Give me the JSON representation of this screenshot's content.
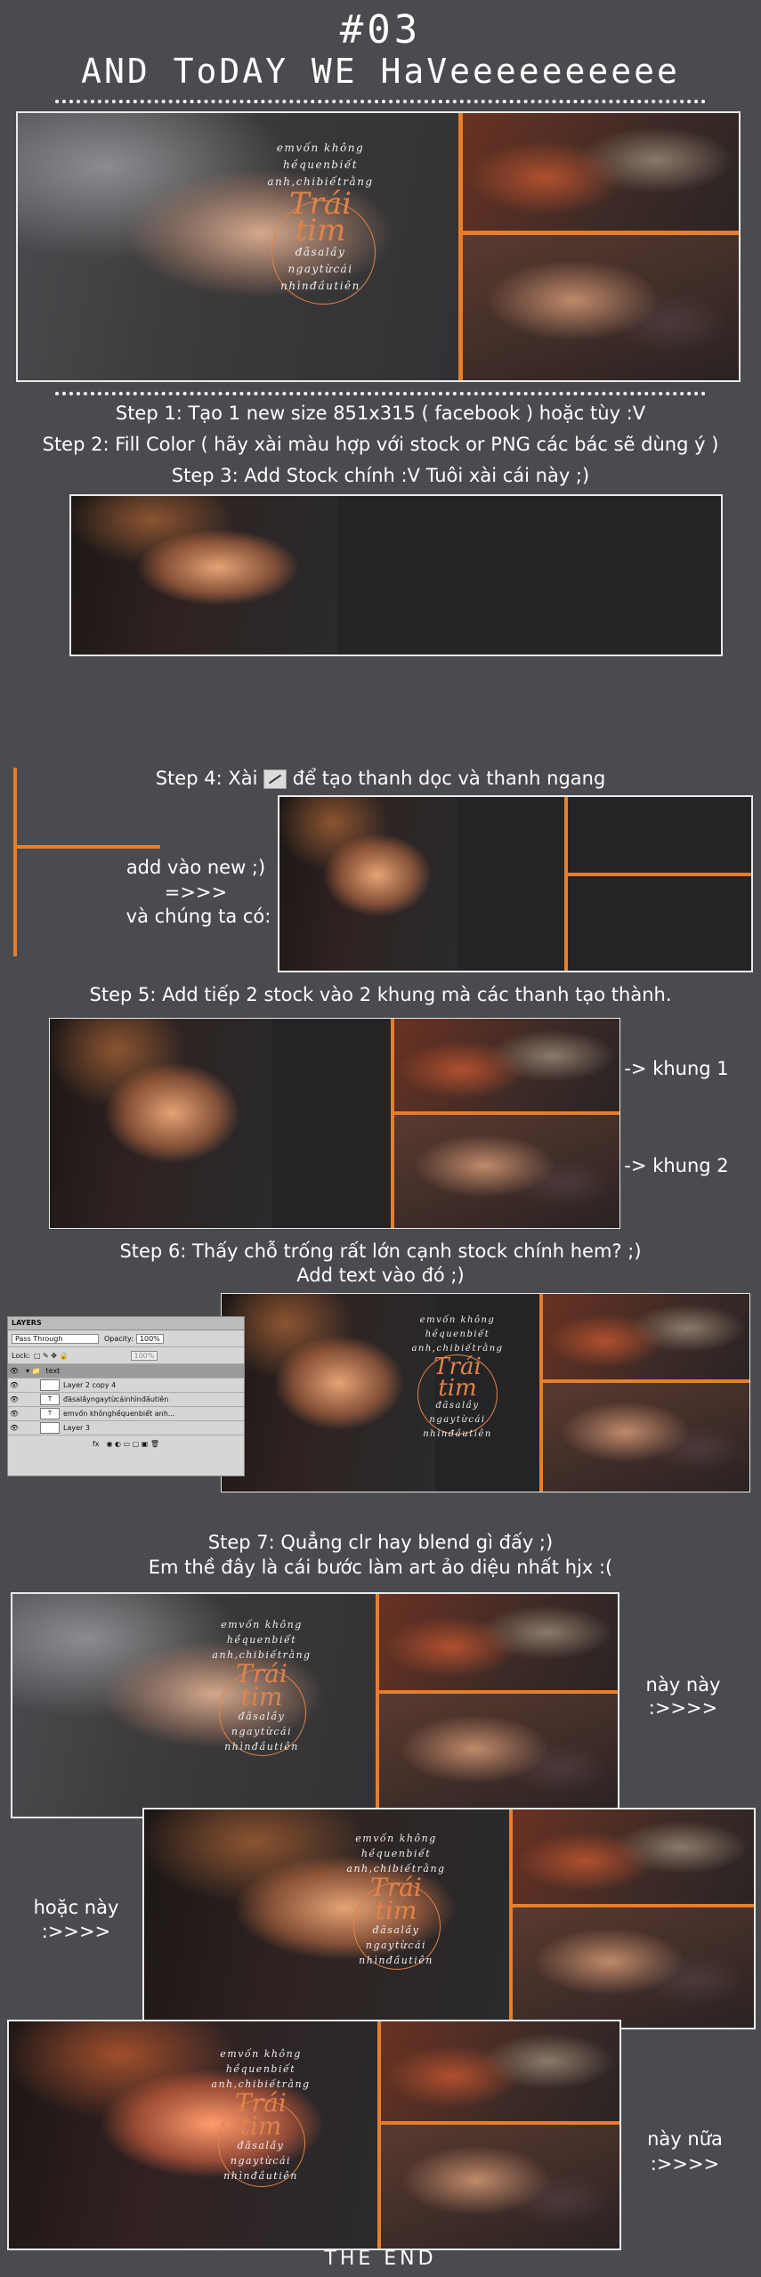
{
  "header": {
    "number": "#03",
    "title": "AND ToDAY WE HaVeeeeeeeeee"
  },
  "banner_text": {
    "line1": "emvốn không",
    "line2": "hềquenbiết",
    "line3": "anh,chibiếtrằng",
    "big1": "Trái",
    "big2": "tim",
    "line4": "đãsalầy",
    "line5": "ngaytừcái",
    "line6": "nhìnđầutiên"
  },
  "steps": {
    "step1": "Step 1: Tạo 1 new size 851x315 ( facebook ) hoặc tùy :V",
    "step2": "Step 2: Fill Color ( hãy xài màu hợp với stock or PNG các bác sẽ dùng ý )",
    "step3": "Step 3: Add Stock chính :V Tuôi xài cái này ;)",
    "step4_pre": "Step 4: Xài",
    "step4_post": "để tạo thanh dọc và thanh ngang",
    "step4_side1": "add vào new ;)",
    "step4_side2": "=>>>",
    "step4_side3": "và chúng ta có:",
    "step5": "Step 5: Add tiếp 2 stock vào 2 khung mà các thanh tạo thành.",
    "khung1": "-> khung 1",
    "khung2": "-> khung 2",
    "step6a": "Step 6: Thấy chỗ trống rất lớn cạnh stock chính hem? ;)",
    "step6b": "Add text vào đó ;)",
    "step7a": "Step 7: Quẳng clr hay blend gì đấy ;)",
    "step7b": "Em thề đây là cái bước làm art ảo diệu nhất hjx :(",
    "result1a": "này này",
    "result1b": ":>>>>",
    "result2a": "hoặc này",
    "result2b": ":>>>>",
    "result3a": "này nữa",
    "result3b": ":>>>>",
    "the_end": "THE END"
  },
  "layers_panel": {
    "tab": "LAYERS",
    "blend_mode": "Pass Through",
    "opacity_label": "Opacity:",
    "opacity_value": "100%",
    "lock_label": "Lock:",
    "fill_value": "100%",
    "group_name": "text",
    "layer1": "Layer 2 copy 4",
    "layer2": "đãsalầyngaytừcáinhìnđầutiên",
    "layer3": "emvốn khônghềquenbiết anh...",
    "layer4": "Layer 3",
    "footer": "fx"
  },
  "colors": {
    "background": "#4a4b4f",
    "accent_orange": "#e67e2c",
    "canvas_dark": "#242426"
  }
}
